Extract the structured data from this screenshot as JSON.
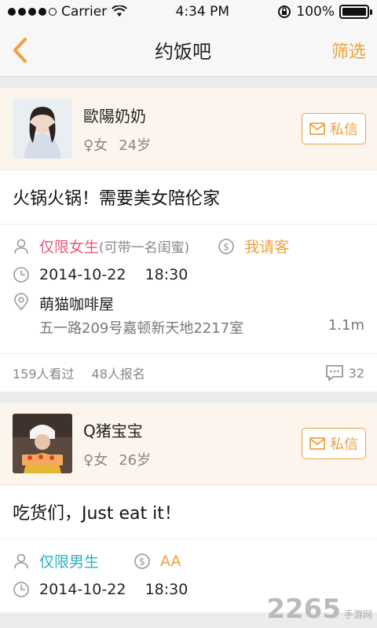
{
  "status_bar": {
    "carrier": "Carrier",
    "time": "4:34 PM",
    "battery": "100%"
  },
  "nav": {
    "title": "约饭吧",
    "filter_label": "筛选"
  },
  "colors": {
    "accent": "#f0a040",
    "female": "#e8597a",
    "male": "#29b3c1"
  },
  "posts": [
    {
      "username": "歐陽奶奶",
      "gender": "♀",
      "gender_label": "女",
      "age": "24岁",
      "message_label": "私信",
      "text": "火锅火锅！需要美女陪伦家",
      "restriction": "仅限女生",
      "restriction_note": "(可带一名闺蜜)",
      "payment": "我请客",
      "datetime": "2014-10-22    18:30",
      "place": "萌猫咖啡屋",
      "address": "五一路209号嘉顿新天地2217室",
      "distance": "1.1m",
      "views": "159人看过",
      "signups": "48人报名",
      "comments": "32"
    },
    {
      "username": "Q猪宝宝",
      "gender": "♀",
      "gender_label": "女",
      "age": "26岁",
      "message_label": "私信",
      "text": "吃货们，Just eat it！",
      "restriction": "仅限男生",
      "payment": "AA",
      "datetime": "2014-10-22    18:30"
    }
  ],
  "watermark": {
    "logo": "2265",
    "sub": "手游网"
  }
}
